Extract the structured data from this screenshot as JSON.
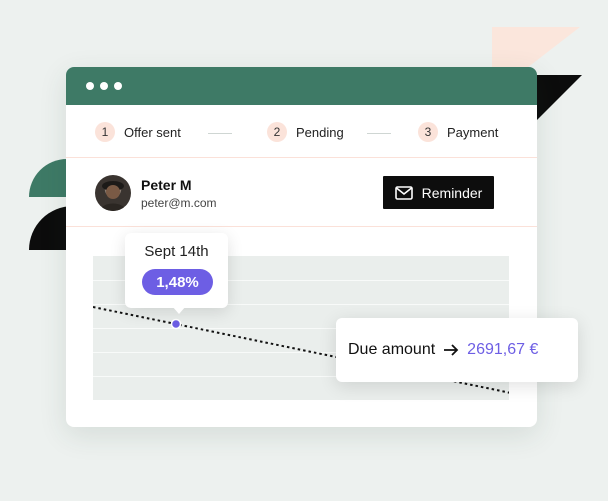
{
  "colors": {
    "background": "#edf1ef",
    "titlebar": "#3e7a66",
    "accent_purple": "#6d5ee4",
    "step_circle": "#fbe3da",
    "button_dark": "#0d0d0d"
  },
  "steps": [
    {
      "number": "1",
      "label": "Offer sent"
    },
    {
      "number": "2",
      "label": "Pending"
    },
    {
      "number": "3",
      "label": "Payment"
    }
  ],
  "user": {
    "name": "Peter M",
    "email": "peter@m.com"
  },
  "reminder": {
    "icon": "mail-icon",
    "label": "Reminder"
  },
  "tooltip": {
    "date": "Sept 14th",
    "value": "1,48%"
  },
  "due": {
    "label": "Due amount",
    "arrow_icon": "arrow-right-icon",
    "value": "2691,67 €"
  }
}
